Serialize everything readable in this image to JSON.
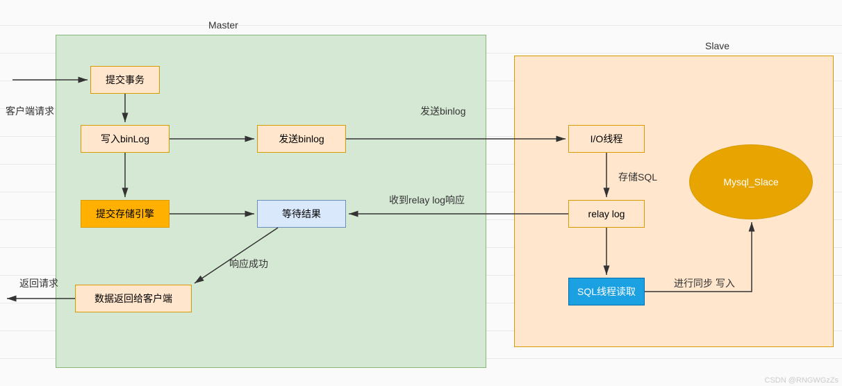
{
  "titles": {
    "master": "Master",
    "slave": "Slave"
  },
  "nodes": {
    "submit_tx": "提交事务",
    "write_binlog": "写入binLog",
    "send_binlog": "发送binlog",
    "commit_engine": "提交存储引擎",
    "wait_result": "等待结果",
    "return_client": "数据返回给客户端",
    "io_thread": "I/O线程",
    "relay_log": "relay log",
    "sql_read": "SQL线程读取",
    "mysql_slave": "Mysql_Slace"
  },
  "labels": {
    "client_request": "客户端请求",
    "return_request": "返回请求",
    "resp_success": "响应成功",
    "send_binlog_edge": "发送binlog",
    "relay_resp": "收到relay log响应",
    "store_sql": "存储SQL",
    "sync_write": "进行同步 写入"
  },
  "watermark": "CSDN @RNGWGzZs"
}
